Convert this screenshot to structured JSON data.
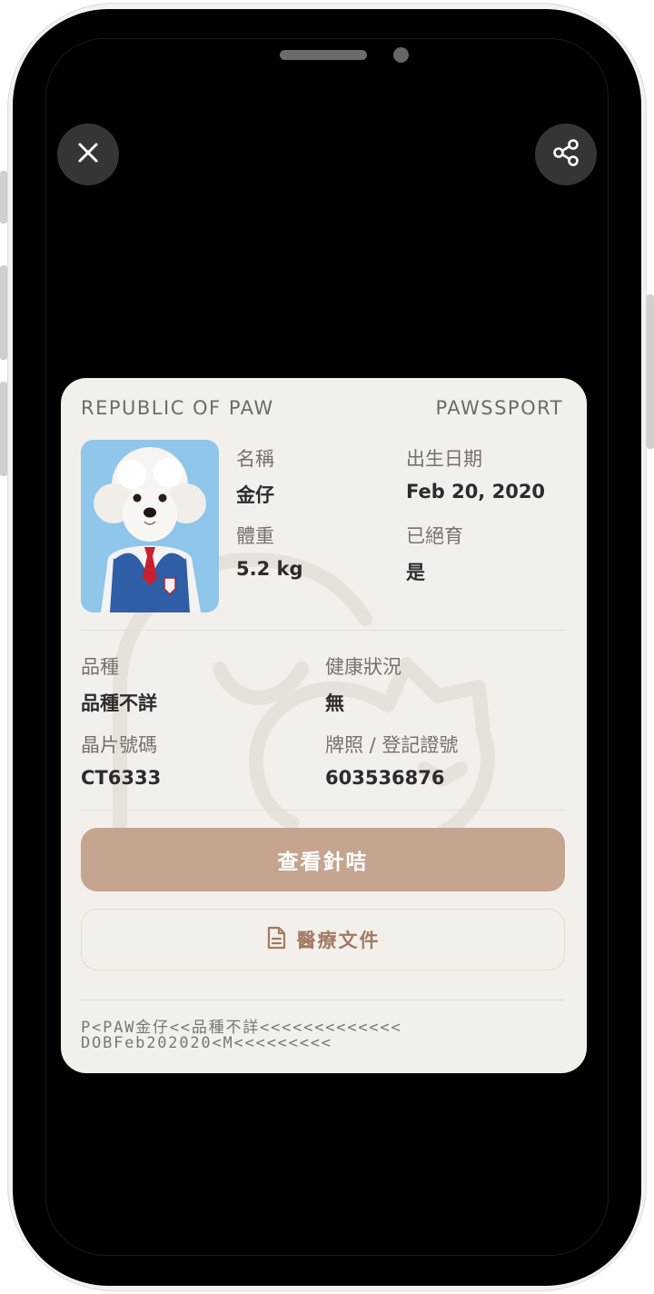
{
  "header": {
    "issuer": "REPUBLIC OF PAW",
    "doc_type": "PAWSSPORT"
  },
  "actions": {
    "close_icon": "close-icon",
    "share_icon": "share-icon"
  },
  "pet": {
    "photo_alt": "白色貴賓狗穿著藍色背心與紅色領帶",
    "name_label": "名稱",
    "name": "金仔",
    "dob_label": "出生日期",
    "dob": "Feb 20, 2020",
    "weight_label": "體重",
    "weight": "5.2 kg",
    "neutered_label": "已絕育",
    "neutered": "是",
    "breed_label": "品種",
    "breed": "品種不詳",
    "health_label": "健康狀況",
    "health": "無",
    "chip_label": "晶片號碼",
    "chip": "CT6333",
    "license_label": "牌照 / 登記證號",
    "license": "603536876"
  },
  "buttons": {
    "vaccines": "查看針咭",
    "medical_docs": "醫療文件"
  },
  "mrz": {
    "line1": "P<PAW金仔<<品種不詳<<<<<<<<<<<<<",
    "line2": "DOBFeb202020<M<<<<<<<<<"
  },
  "colors": {
    "card_bg": "#f3f0ec",
    "primary_button": "#c5a590",
    "accent_text": "#a27a63"
  }
}
